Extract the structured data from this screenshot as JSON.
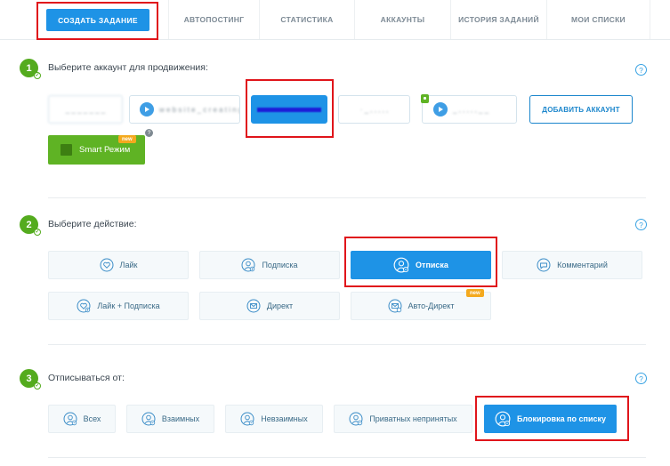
{
  "nav": {
    "create": "СОЗДАТЬ ЗАДАНИЕ",
    "tabs": [
      "АВТОПОСТИНГ",
      "СТАТИСТИКА",
      "АККАУНТЫ",
      "ИСТОРИЯ ЗАДАНИЙ",
      "МОИ СПИСКИ"
    ]
  },
  "step1": {
    "number": "1",
    "title": "Выберите аккаунт для продвижения:",
    "help": "?",
    "accounts": [
      "_ _ _ _ _ _ _",
      "w e b s i t e _ c r e a t i n g _",
      "",
      "· _ , , , , ,",
      "_ , , , , , _ _"
    ],
    "add_account": "ДОБАВИТЬ АККАУНТ",
    "smart_mode": "Smart Режим",
    "new_badge": "new",
    "small_help": "?"
  },
  "step2": {
    "number": "2",
    "title": "Выберите действие:",
    "help": "?",
    "actions": [
      "Лайк",
      "Подписка",
      "Отписка",
      "Комментарий",
      "Лайк + Подписка",
      "Директ",
      "Авто-Директ"
    ],
    "new_badge": "new"
  },
  "step3": {
    "number": "3",
    "title": "Отписываться от:",
    "help": "?",
    "options": [
      "Всех",
      "Взаимных",
      "Невзаимных",
      "Приватных непринятых",
      "Блокировка по списку"
    ]
  },
  "colors": {
    "accent": "#1e93e6",
    "success": "#54ab1e",
    "smart": "#5fb324",
    "badge": "#f4a91e",
    "annotation": "#e0151b"
  }
}
